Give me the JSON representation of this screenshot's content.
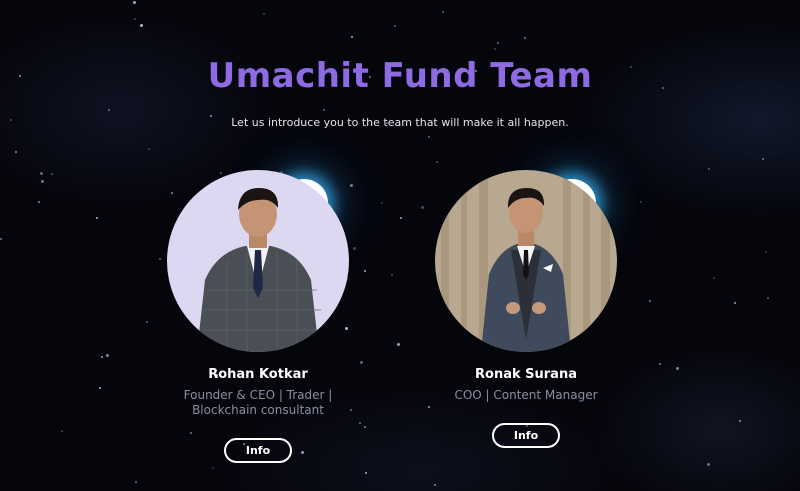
{
  "header": {
    "title": "Umachit Fund Team",
    "subtitle": "Let us introduce you to the team that will make it all happen."
  },
  "team": [
    {
      "name": "Rohan Kotkar",
      "role": "Founder & CEO | Trader | Blockchain consultant",
      "button": "Info",
      "photo_icon": "person-photo",
      "photo_background": "#ddd8f1"
    },
    {
      "name": "Ronak Surana",
      "role": "COO | Content Manager",
      "button": "Info",
      "photo_icon": "person-photo",
      "photo_background": "#b8a890"
    }
  ],
  "colors": {
    "title": "#8f6be3",
    "background": "#06060d",
    "glow": "#3cbeff"
  }
}
